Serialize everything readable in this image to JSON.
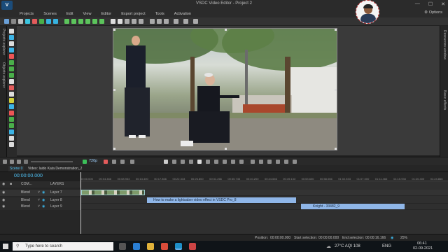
{
  "window": {
    "title": "VSDC Video Editor - Project 2",
    "logo": "V"
  },
  "menu": {
    "items": [
      "Projects",
      "Scenes",
      "Edit",
      "View",
      "Editor",
      "Export project",
      "Tools",
      "Activation"
    ],
    "options": "Options"
  },
  "side": {
    "left_tabs": [
      "Projects explorer",
      "Objects explorer"
    ],
    "right_tabs": [
      "Resources window",
      "Basic effects"
    ]
  },
  "transport": {
    "zoom": "720p"
  },
  "timeline": {
    "scene_tab": "Scene 0",
    "file_tab": "Video: Iaido Kata Demonstration_2",
    "timecode": "00:00:00.000",
    "col_headers": {
      "com": "COM...",
      "layers": "LAYERS"
    },
    "ruler": [
      "00:00.000",
      "00:04.466",
      "00:08.933",
      "00:13.400",
      "00:17.866",
      "00:22.333",
      "00:26.800",
      "00:31.266",
      "00:35.733",
      "00:40.200",
      "00:44.666",
      "00:49.133",
      "00:53.600",
      "00:58.066",
      "01:02.533",
      "01:07.000",
      "01:11.466",
      "01:15.933",
      "01:20.400",
      "01:24.866"
    ],
    "tracks": [
      {
        "blend": "Blend",
        "layer": "Layer 7"
      },
      {
        "blend": "Blend",
        "layer": "Layer 8"
      },
      {
        "blend": "Blend",
        "layer": "Layer 9"
      }
    ],
    "clips": {
      "lightsaber": "How to make a lightsaber video effect in VSDC Pro_8",
      "knight": "Knight - 33482_9"
    }
  },
  "status": {
    "position_label": "Position:",
    "position": "00:00:00.000",
    "start_label": "Start selection:",
    "start": "00:00:00.000",
    "end_label": "End selection:",
    "end": "00:00:16.166",
    "zoom": "25%"
  },
  "taskbar": {
    "search_placeholder": "Type here to search",
    "weather": "27°C AQI 108",
    "lang": "ENG",
    "time": "06:41",
    "date": "02-09-2021"
  },
  "colors": {
    "accent": "#4fc3f7",
    "clip_blue": "#8fb6e8",
    "timecode": "#4fc3f7"
  }
}
